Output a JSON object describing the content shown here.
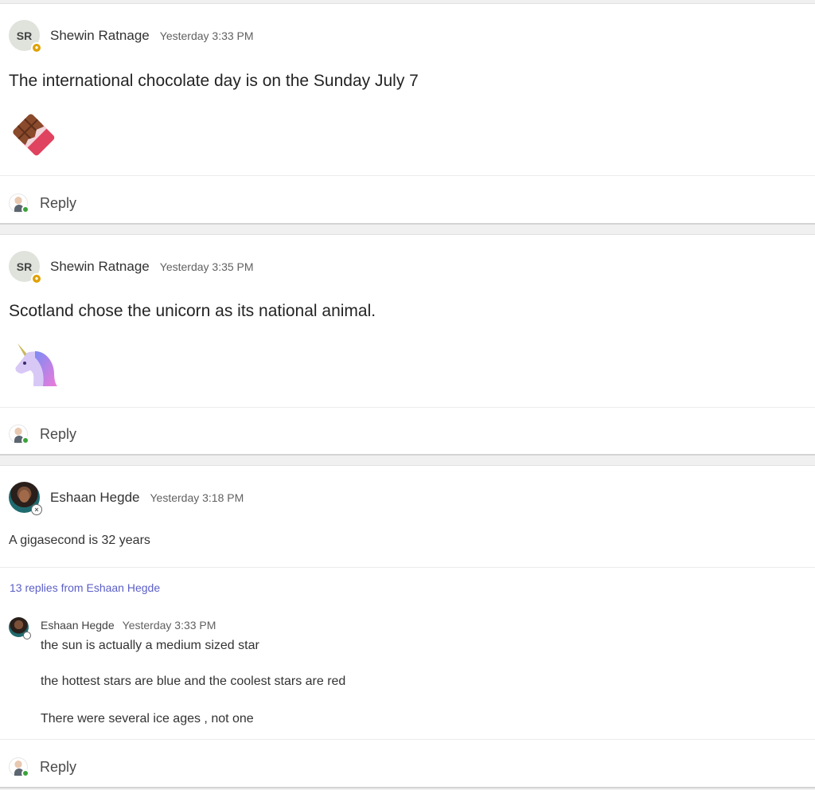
{
  "posts": [
    {
      "avatar_initials": "SR",
      "author": "Shewin Ratnage",
      "time": "Yesterday 3:33 PM",
      "subject": "The international chocolate day is on the Sunday July 7",
      "emoji": "chocolate-bar",
      "reply_label": "Reply"
    },
    {
      "avatar_initials": "SR",
      "author": "Shewin Ratnage",
      "time": "Yesterday 3:35 PM",
      "subject": "Scotland chose the unicorn as its national animal.",
      "emoji": "unicorn",
      "reply_label": "Reply"
    },
    {
      "author": "Eshaan Hegde",
      "time": "Yesterday 3:18 PM",
      "body": "A gigasecond is 32 years",
      "replies_link": "13 replies from Eshaan Hegde",
      "thread": {
        "author": "Eshaan Hegde",
        "time": "Yesterday 3:33 PM",
        "lines": [
          "the sun is actually a medium sized star",
          "the hottest stars are blue and the coolest stars are red",
          "There were several ice ages , not one"
        ]
      },
      "reply_label": "Reply"
    }
  ],
  "colors": {
    "link": "#5b5fc7",
    "away": "#e0a100",
    "online": "#3aa33a"
  }
}
